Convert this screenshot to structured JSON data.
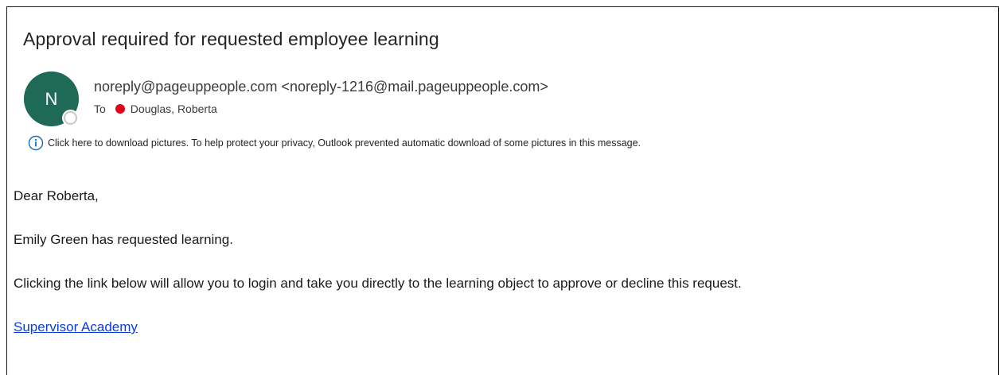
{
  "email": {
    "subject": "Approval required for requested employee learning",
    "sender": {
      "avatar_initial": "N",
      "display": "noreply@pageuppeople.com <noreply-1216@mail.pageuppeople.com>"
    },
    "to": {
      "label": "To",
      "recipient": "Douglas, Roberta",
      "status_color": "#e3001b"
    },
    "info_bar": {
      "icon": "info-icon",
      "text": "Click here to download pictures. To help protect your privacy, Outlook prevented automatic download of some pictures in this message."
    },
    "body": {
      "greeting": "Dear Roberta,",
      "paragraph_1": "Emily Green has requested learning.",
      "paragraph_2": "Clicking the link below will allow you to login and take you directly to the learning object to approve or decline this request.",
      "link_text": "Supervisor Academy"
    }
  },
  "colors": {
    "avatar_bg": "#1e6a56",
    "link": "#0b3ddc",
    "info_icon": "#0f6cbd"
  }
}
